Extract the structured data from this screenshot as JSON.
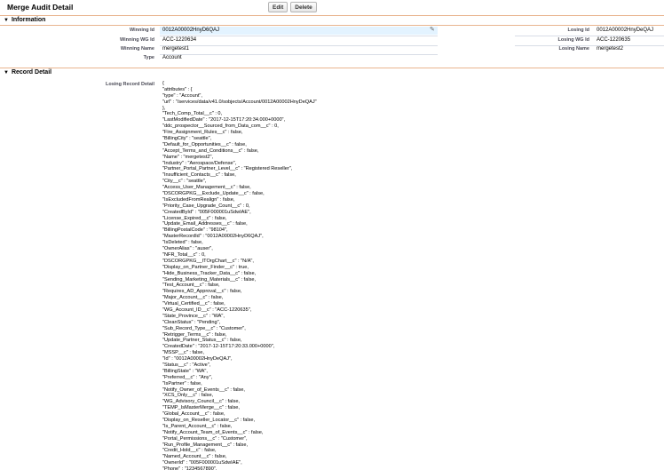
{
  "header": {
    "title": "Merge Audit Detail",
    "edit_label": "Edit",
    "delete_label": "Delete"
  },
  "information": {
    "heading": "Information",
    "left": [
      {
        "label": "Winning Id",
        "value": "0012A00002HnyD6QAJ"
      },
      {
        "label": "Winning WG Id",
        "value": "ACC-1220634"
      },
      {
        "label": "Winning Name",
        "value": "mergetest1"
      },
      {
        "label": "Type",
        "value": "Account"
      }
    ],
    "right": [
      {
        "label": "Losing Id",
        "value": "0012A00002HnyDeQAJ"
      },
      {
        "label": "Losing WG Id",
        "value": "ACC-1220635"
      },
      {
        "label": "Losing Name",
        "value": "mergetest2"
      }
    ]
  },
  "record_detail": {
    "heading": "Record Detail",
    "label": "Losing Record Detail",
    "lines": [
      "{",
      "\"attributes\" : {",
      "\"type\" : \"Account\",",
      "\"url\" : \"/services/data/v41.0/sobjects/Account/0012A00002HnyDeQAJ\"",
      "},",
      "\"Tech_Comp_Total__c\" : 0,",
      "\"LastModifiedDate\" : \"2017-12-15T17:20:34.000+0000\",",
      "\"ddc_prospector__Sourced_from_Data_com__c\" : 0,",
      "\"Fire_Assignment_Rules__c\" : false,",
      "\"BillingCity\" : \"seattle\",",
      "\"Default_for_Opportunities__c\" : false,",
      "\"Accept_Terms_and_Conditions__c\" : false,",
      "\"Name\" : \"mergetest2\",",
      "\"Industry\" : \"Aerospace/Defense\",",
      "\"Partner_Portal_Partner_Level__c\" : \"Registered Reseller\",",
      "\"Insufficient_Contacts__c\" : false,",
      "\"City__c\" : \"seattle\",",
      "\"Access_User_Management__c\" : false,",
      "\"DSCORGPKG__Exclude_Update__c\" : false,",
      "\"IsExcludedFromRealign\" : false,",
      "\"Priority_Case_Upgrade_Count__c\" : 0,",
      "\"CreatedById\" : \"005F000001uSdwIAE\",",
      "\"License_Expired__c\" : false,",
      "\"Update_Email_Addresses__c\" : false,",
      "\"BillingPostalCode\" : \"98104\",",
      "\"MasterRecordId\" : \"0012A00002HnyD6QAJ\",",
      "\"IsDeleted\" : false,",
      "\"OwnerAlias\" : \"auser\",",
      "\"NFR_Total__c\" : 0,",
      "\"DSCORGPKG__ITOrgChart__c\" : \"N/A\",",
      "\"Display_on_Partner_Finder__c\" : true,",
      "\"Hide_Business_Tracker_Data__c\" : false,",
      "\"Sending_Marketing_Materials__c\" : false,",
      "\"Test_Account__c\" : false,",
      "\"Requires_AD_Approval__c\" : false,",
      "\"Major_Account__c\" : false,",
      "\"Virtual_Certified__c\" : false,",
      "\"WG_Account_ID__c\" : \"ACC-1220635\",",
      "\"State_Province__c\" : \"WA\",",
      "\"CleanStatus\" : \"Pending\",",
      "\"Sub_Record_Type__c\" : \"Customer\",",
      "\"Retrigger_Terms__c\" : false,",
      "\"Update_Partner_Status__c\" : false,",
      "\"CreatedDate\" : \"2017-12-15T17:20:33.000+0000\",",
      "\"MSSP__c\" : false,",
      "\"Id\" : \"0012A00002HnyDeQAJ\",",
      "\"Status__c\" : \"Active\",",
      "\"BillingState\" : \"WA\",",
      "\"Preferred__c\" : \"Any\",",
      "\"IsPartner\" : false,",
      "\"Notify_Owner_of_Events__c\" : false,",
      "\"XCS_Only__c\" : false,",
      "\"WG_Advisory_Council__c\" : false,",
      "\"TEMP_IsMasterMerge__c\" : false,",
      "\"Global_Account__c\" : false,",
      "\"Display_on_Reseller_Locator__c\" : false,",
      "\"Is_Parent_Account__c\" : false,",
      "\"Notify_Account_Team_of_Events__c\" : false,",
      "\"Portal_Permissions__c\" : \"Customer\",",
      "\"Run_Profile_Management__c\" : false,",
      "\"Credit_Hold__c\" : false,",
      "\"Named_Account__c\" : false,",
      "\"OwnerId\" : \"005F000001uSdwIAE\",",
      "\"Phone\" : \"1234567890\","
    ]
  },
  "icons": {
    "collapse": "triangle-down-icon",
    "edit_inline": "pencil-icon"
  },
  "colors": {
    "section_rule": "#e9b590",
    "highlight": "#e3f3ff"
  }
}
